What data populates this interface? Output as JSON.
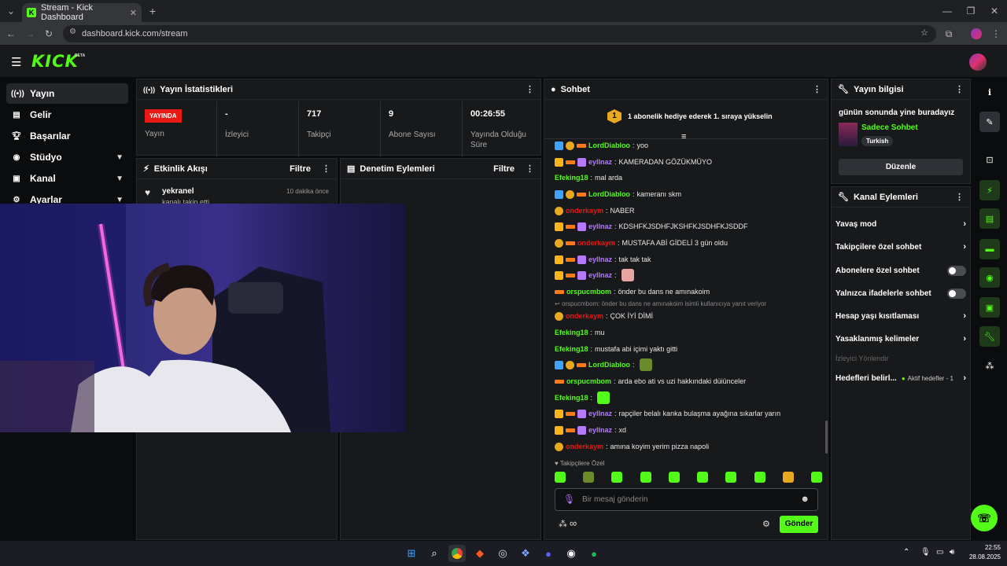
{
  "browser": {
    "tab_title": "Stream - Kick Dashboard",
    "url": "dashboard.kick.com/stream"
  },
  "kick": {
    "logo": "KICK",
    "beta": "BETA"
  },
  "sidebar": {
    "items": [
      {
        "label": "Yayın",
        "icon": "broadcast-icon"
      },
      {
        "label": "Gelir",
        "icon": "revenue-icon"
      },
      {
        "label": "Başarılar",
        "icon": "trophy-icon"
      },
      {
        "label": "Stüdyo",
        "icon": "studio-icon"
      },
      {
        "label": "Kanal",
        "icon": "channel-icon"
      },
      {
        "label": "Ayarlar",
        "icon": "gear-icon"
      }
    ]
  },
  "stats": {
    "title": "Yayın İstatistikleri",
    "live_badge": "YAYINDA",
    "live_label": "Yayın",
    "viewers_value": "-",
    "viewers_label": "İzleyici",
    "followers_value": "717",
    "followers_label": "Takipçi",
    "subs_value": "9",
    "subs_label": "Abone Sayısı",
    "duration_value": "00:26:55",
    "duration_label": "Yayında Olduğu Süre"
  },
  "activity": {
    "title": "Etkinlik Akışı",
    "filter": "Filtre",
    "items": [
      {
        "user": "yekranel",
        "text": "kanalı takip etti",
        "time": "10 dakika önce"
      }
    ]
  },
  "moderation": {
    "title": "Denetim Eylemleri",
    "filter": "Filtre"
  },
  "chat": {
    "title": "Sohbet",
    "pinned": "1 abonelik hediye ederek 1. sıraya yükselin",
    "pinned_rank": "1",
    "followers_only_label": "Takipçilere Özel",
    "input_placeholder": "Bir mesaj gönderin",
    "send_label": "Gönder",
    "infinity": "∞",
    "reply_preview": "orspucmbom: önder bu dans ne amınakoim isimli kullanıcıya yanıt veriyor",
    "messages": [
      {
        "user": "LordDiabloo",
        "color": "#53fc18",
        "badges": [
          "b-blue",
          "b-gold",
          "b-orange"
        ],
        "text": "yoo"
      },
      {
        "user": "eyllnaz",
        "color": "#b779ff",
        "badges": [
          "b-crown",
          "b-orange",
          "b-purple"
        ],
        "text": "KAMERADAN GÖZÜKMÜYO"
      },
      {
        "user": "Efeking18",
        "color": "#53fc18",
        "badges": [],
        "text": "mal arda"
      },
      {
        "user": "LordDiabloo",
        "color": "#53fc18",
        "badges": [
          "b-blue",
          "b-gold",
          "b-orange"
        ],
        "text": "kameranı skm"
      },
      {
        "user": "onderkaym",
        "color": "#e91916",
        "badges": [
          "b-gold"
        ],
        "text": "NABER"
      },
      {
        "user": "eyllnaz",
        "color": "#b779ff",
        "badges": [
          "b-crown",
          "b-orange",
          "b-purple"
        ],
        "text": "KDSHFKJSDHFJKSHFKJSDHFKJSDDF"
      },
      {
        "user": "onderkaym",
        "color": "#e91916",
        "badges": [
          "b-gold",
          "b-orange"
        ],
        "text": "MUSTAFA ABİ GİDELİ 3 gün oldu"
      },
      {
        "user": "eyllnaz",
        "color": "#b779ff",
        "badges": [
          "b-crown",
          "b-orange",
          "b-purple"
        ],
        "text": "tak tak tak"
      },
      {
        "user": "eyllnaz",
        "color": "#b779ff",
        "badges": [
          "b-crown",
          "b-orange",
          "b-purple"
        ],
        "text": "",
        "emote": "#e8a3a3"
      },
      {
        "user": "orspucmbom",
        "color": "#53fc18",
        "badges": [
          "b-orange"
        ],
        "text": "önder bu dans ne amınakoim"
      },
      {
        "user": "onderkaym",
        "color": "#e91916",
        "badges": [
          "b-gold"
        ],
        "text": "ÇOK İYİ DİMİ"
      },
      {
        "user": "Efeking18",
        "color": "#53fc18",
        "badges": [],
        "text": "mu"
      },
      {
        "user": "Efeking18",
        "color": "#53fc18",
        "badges": [],
        "text": "mustafa abi içimi yaktı gitti"
      },
      {
        "user": "LordDiabloo",
        "color": "#53fc18",
        "badges": [
          "b-blue",
          "b-gold",
          "b-orange"
        ],
        "text": "",
        "emote": "#6b8a2a"
      },
      {
        "user": "orspucmbom",
        "color": "#53fc18",
        "badges": [
          "b-orange"
        ],
        "text": "arda ebo ati vs uzi hakkındaki düiünceler"
      },
      {
        "user": "Efeking18",
        "color": "#53fc18",
        "badges": [],
        "text": "",
        "emote": "#53fc18"
      },
      {
        "user": "eyllnaz",
        "color": "#b779ff",
        "badges": [
          "b-crown",
          "b-orange",
          "b-purple"
        ],
        "text": "rapçiler belalı kanka bulaşma ayağına sıkarlar yarın"
      },
      {
        "user": "eyllnaz",
        "color": "#b779ff",
        "badges": [
          "b-crown",
          "b-orange",
          "b-purple"
        ],
        "text": "xd"
      },
      {
        "user": "onderkaym",
        "color": "#e91916",
        "badges": [
          "b-gold"
        ],
        "text": "amına koyim yerim pizza napoli"
      }
    ]
  },
  "stream_info": {
    "title": "Yayın bilgisi",
    "stream_title": "günün sonunda yine buradayız",
    "category": "Sadece Sohbet",
    "language_tag": "Turkish",
    "edit_label": "Düzenle"
  },
  "channel_actions": {
    "title": "Kanal Eylemleri",
    "items": [
      {
        "label": "Yavaş mod",
        "type": "arrow"
      },
      {
        "label": "Takipçilere özel sohbet",
        "type": "arrow"
      },
      {
        "label": "Abonelere özel sohbet",
        "type": "toggle"
      },
      {
        "label": "Yalnızca ifadelerle sohbet",
        "type": "toggle"
      },
      {
        "label": "Hesap yaşı kısıtlaması",
        "type": "arrow"
      },
      {
        "label": "Yasaklanmış kelimeler",
        "type": "arrow"
      }
    ],
    "section_label": "İzleyici Yönlendir",
    "goals_label": "Hedefleri belirl...",
    "goals_status": "Aktif hedefler - 1"
  },
  "taskbar": {
    "time": "22:55",
    "date": "28.08.2025"
  },
  "colors": {
    "brand": "#53fc18",
    "live": "#e91916",
    "panel": "#18191b"
  }
}
